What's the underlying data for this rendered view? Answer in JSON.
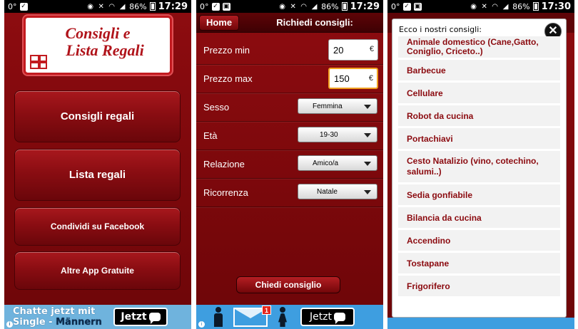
{
  "screen1": {
    "status": {
      "left": "0°",
      "battery": "86%",
      "time": "17:29"
    },
    "logo": {
      "line1": "Consigli e",
      "line2": "Lista Regali"
    },
    "buttons": [
      "Consigli regali",
      "Lista regali",
      "Condividi su Facebook",
      "Altre App Gratuite"
    ],
    "ad": {
      "line1_a": "Chatte jetzt mit",
      "line2_a": "Single -",
      "line2_b": "Männern",
      "cta": "Jetzt"
    }
  },
  "screen2": {
    "status": {
      "left": "0°",
      "battery": "86%",
      "time": "17:29"
    },
    "home": "Home",
    "title": "Richiedi consigli:",
    "fields": {
      "prezzo_min": {
        "label": "Prezzo min",
        "value": "20",
        "unit": "€"
      },
      "prezzo_max": {
        "label": "Prezzo max",
        "value": "150",
        "unit": "€"
      },
      "sesso": {
        "label": "Sesso",
        "value": "Femmina"
      },
      "eta": {
        "label": "Età",
        "value": "19-30"
      },
      "relazione": {
        "label": "Relazione",
        "value": "Amico/a"
      },
      "ricorrenza": {
        "label": "Ricorrenza",
        "value": "Natale"
      }
    },
    "ask": "Chiedi consiglio",
    "ad": {
      "badge": "1",
      "cta": "Jetzt"
    }
  },
  "screen3": {
    "status": {
      "left": "0°",
      "battery": "86%",
      "time": "17:30"
    },
    "title": "Ecco i nostri consigli:",
    "items": [
      "Animale domestico (Cane,Gatto, Coniglio, Criceto..)",
      "Barbecue",
      "Cellulare",
      "Robot da cucina",
      "Portachiavi",
      "Cesto Natalizio (vino, cotechino, salumi..)",
      "Sedia gonfiabile",
      "Bilancia da cucina",
      "Accendino",
      "Tostapane",
      "Frigorifero"
    ]
  }
}
